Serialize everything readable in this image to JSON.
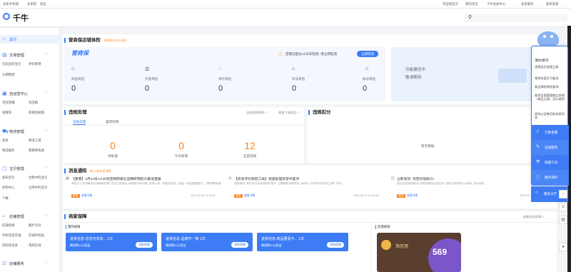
{
  "topbar": {
    "left": [
      "卖家手机端",
      "卖家帮",
      "退出"
    ],
    "right": [
      "淘宝网首页",
      "我的淘宝",
      "千牛卖家中心",
      "卖家服务",
      "联系客服"
    ]
  },
  "header": {
    "logo": "千牛",
    "search_placeholder": ""
  },
  "sidebar": {
    "home": "首页",
    "groups": [
      {
        "label": "交易管理",
        "subs": [
          "已卖出的宝贝",
          "评价管理",
          "分期管理"
        ]
      },
      {
        "label": "自运营中心",
        "subs": [
          "淘宝直播",
          "淘宝群",
          "发微淘",
          "商家短视频"
        ]
      },
      {
        "label": "物流管理",
        "subs": [
          "发货",
          "物流工具",
          "物流服务",
          "我要寄快递"
        ]
      },
      {
        "label": "宝贝管理",
        "subs": [
          "发布宝贝",
          "出售中的宝贝",
          "体检中心",
          "仓库中的宝贝",
          "个数"
        ]
      },
      {
        "label": "店铺管理",
        "subs": [
          "店铺装修",
          "图片空间",
          "手机淘宝店铺",
          "店铺手机板",
          "风险保证金",
          "电商在线"
        ]
      },
      {
        "label": "店铺服务",
        "subs": []
      }
    ]
  },
  "store_health": {
    "title": "营商保店铺体检",
    "subtitle": "检测时间 12天前",
    "brand": "营商保",
    "alert": "店铺已超过12天未检测, 请立即检测",
    "check_button": "立即检测",
    "metrics": [
      {
        "label": "商品风险",
        "value": "0",
        "icon": "bag-icon"
      },
      {
        "label": "交易风险",
        "value": "0",
        "icon": "receipt-icon"
      },
      {
        "label": "评价风险",
        "value": "0",
        "icon": "chat-icon"
      },
      {
        "label": "司法风险",
        "value": "0",
        "icon": "court-icon"
      },
      {
        "label": "账号风险",
        "value": "0",
        "icon": "lock-icon"
      }
    ],
    "promo_line1": "功能建设中",
    "promo_line2": "敬请期待"
  },
  "violations": {
    "title": "违规处理",
    "links": [
      "全部规则权限 >",
      "查看下架商品 >"
    ],
    "tabs": [
      "违规处理",
      "差错权限"
    ],
    "counts": [
      {
        "value": "0",
        "label": "待处理"
      },
      {
        "value": "0",
        "label": "今日新增"
      },
      {
        "value": "12",
        "label": "全部违规"
      }
    ]
  },
  "violation_points": {
    "title": "违规扣分",
    "empty": "暂无数据"
  },
  "notices": {
    "title": "消息通知",
    "subtitle": "每 5 条未读消息",
    "items": [
      {
        "title": "【重要】2月10日14:00淘宝网商家信息精研预揽大解读直播",
        "body": "淘宝小二在线解读在线精研店铺, 内容主要包括: 网商部分的问题, 规则汇新...视频受启动。重温一直是首推重点, 了解你想知道!",
        "tag": "重要",
        "link": "查看详情",
        "date": "2020-02-14 21:53:11"
      },
      {
        "title": "【异常评价防控工具】快速处理异常中差评",
        "body": "您想要的, 现在可以在线管理中差评, 正确清楚详细给出! 请进行【异常评价防控工具】评价...",
        "tag": "重要",
        "link": "查看详情",
        "date": "2020-02-13 15:46:46"
      },
      {
        "title": "立即发货, 淘宝补贴助力!",
        "body": "商品发货规划建议! 您的店铺货品是否好, 您和立即规划1元补贴, 实际补贴...",
        "tag": "重要",
        "link": "查看详情",
        "date": "2020-02-13 12:23:08"
      }
    ]
  },
  "assurance": {
    "title": "商家保障",
    "link": "查看全部保障 >",
    "left_label": "我的保障",
    "cards": [
      {
        "title": "退货信息-信息与实际... 1次",
        "sub": "需保障10元权益",
        "btn": "领取保障"
      },
      {
        "title": "退货信息-品牌不一致 1次",
        "sub": "需保障10元权益",
        "btn": "领取保障"
      },
      {
        "title": "退货信息-商品要素不... 1次",
        "sub": "需保障10元权益",
        "btn": "领取保障"
      }
    ],
    "right_label": "友情链接",
    "credit_label": "淘信用",
    "credit_score": "569"
  },
  "assistant": {
    "prompt": "请你想问:",
    "questions": [
      "违规宝贝处理工具",
      "相关抗疫学习板块",
      "商品降权原因查询",
      "商家全面管理商品合规（商品工具）怎么使用",
      "如何认证售后和卖家信息"
    ],
    "actions": [
      {
        "label": "万象客服",
        "icon": "bell-icon"
      },
      {
        "label": "自助服务",
        "icon": "edit-icon"
      },
      {
        "label": "快捷工具",
        "icon": "wrench-icon"
      },
      {
        "label": "服务资料",
        "icon": "info-icon"
      },
      {
        "label": "服务大厅",
        "icon": "home-icon"
      }
    ]
  },
  "right_tools": [
    "↑",
    "≡",
    "▤",
    "●"
  ]
}
